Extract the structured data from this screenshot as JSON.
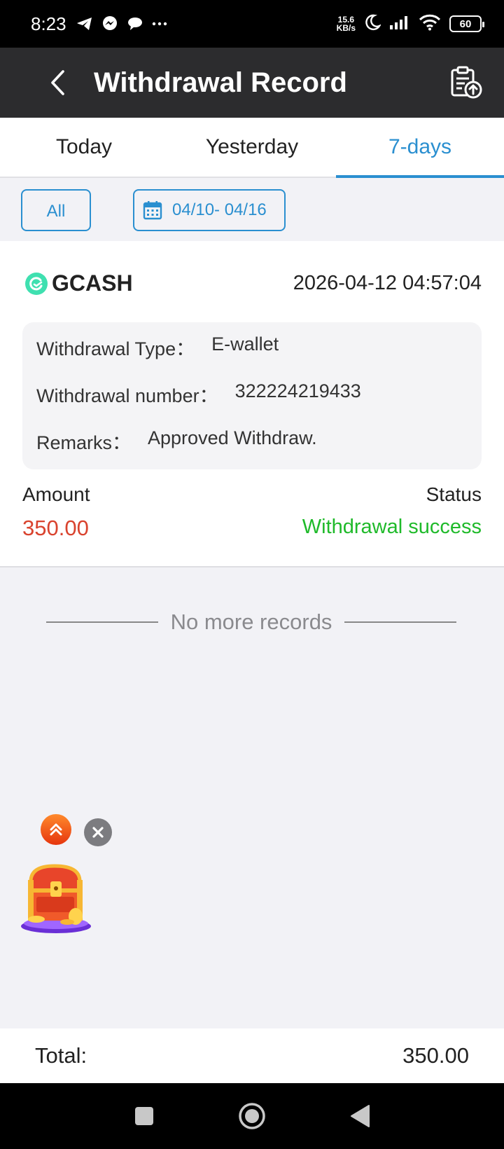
{
  "status_bar": {
    "time": "8:23",
    "speed_value": "15.6",
    "speed_unit": "KB/s",
    "battery": "60",
    "icons": [
      "telegram-icon",
      "messenger-icon",
      "chat-bubble-icon",
      "more-dots-icon",
      "moon-icon",
      "signal-icon",
      "wifi-icon",
      "battery-icon"
    ]
  },
  "app_bar": {
    "title": "Withdrawal Record",
    "back_icon": "chevron-left-icon",
    "action_icon": "clipboard-upload-icon"
  },
  "tabs": [
    {
      "label": "Today",
      "active": false
    },
    {
      "label": "Yesterday",
      "active": false
    },
    {
      "label": "7-days",
      "active": true
    }
  ],
  "filters": {
    "all_label": "All",
    "date_range": "04/10- 04/16",
    "date_icon": "calendar-icon"
  },
  "record": {
    "provider": "GCASH",
    "datetime": "2026-04-12 04:57:04",
    "type_label": "Withdrawal Type：",
    "type_value": "E-wallet",
    "number_label": "Withdrawal number：",
    "number_value": "322224219433",
    "remarks_label": "Remarks：",
    "remarks_value": "Approved Withdraw.",
    "amount_label": "Amount",
    "amount_value": "350.00",
    "status_label": "Status",
    "status_value": "Withdrawal success"
  },
  "list_end_text": "No more records",
  "footer": {
    "total_label": "Total:",
    "total_value": "350.00"
  },
  "colors": {
    "accent": "#2a8fd0",
    "amount": "#d9432e",
    "success": "#1fba2a",
    "app_bar": "#2c2c2e"
  }
}
